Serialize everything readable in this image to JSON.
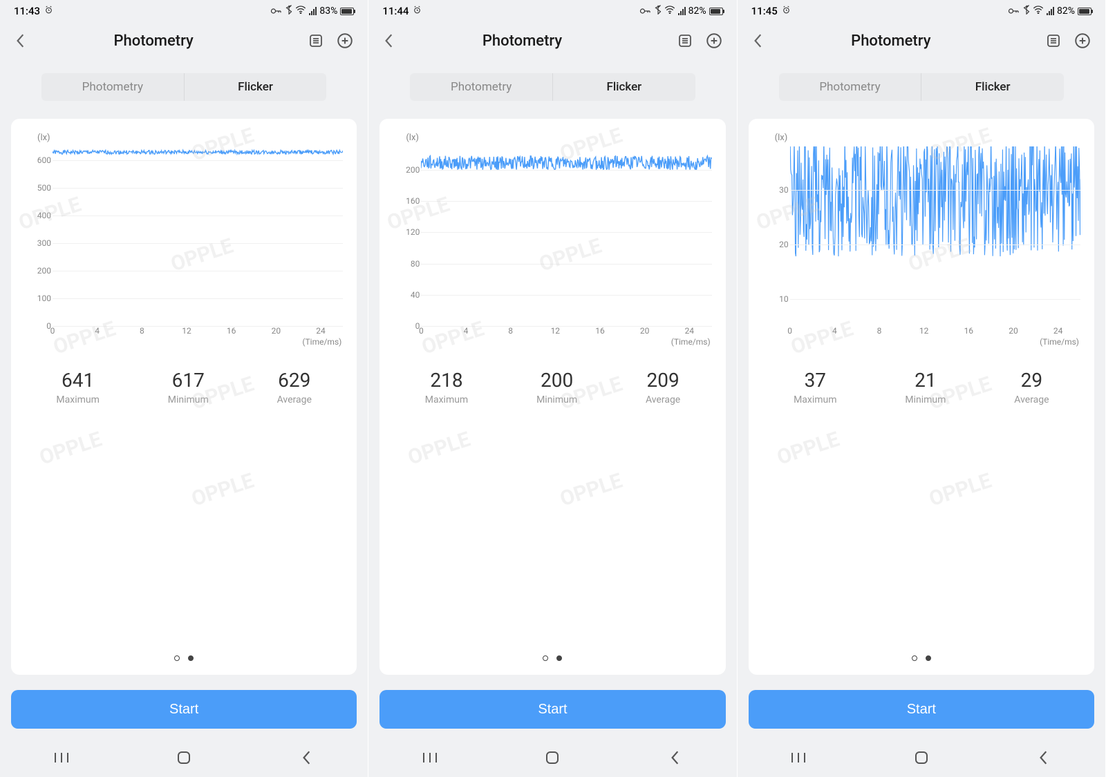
{
  "screens": [
    {
      "status": {
        "time": "11:43",
        "battery_pct": "83%",
        "battery_fill": 83
      },
      "header": {
        "title": "Photometry"
      },
      "tabs": {
        "photometry": "Photometry",
        "flicker": "Flicker",
        "active": "flicker"
      },
      "chart": {
        "unit": "(lx)",
        "y_ticks": [
          0,
          100,
          200,
          300,
          400,
          500,
          600
        ],
        "y_max": 650,
        "x_ticks": [
          0,
          4,
          8,
          12,
          16,
          20,
          24
        ],
        "x_max": 26,
        "x_label": "(Time/ms)",
        "mean": 629,
        "amp": 12,
        "noise": 1.2
      },
      "stats": {
        "max_val": "641",
        "max_lab": "Maximum",
        "min_val": "617",
        "min_lab": "Minimum",
        "avg_val": "629",
        "avg_lab": "Average"
      },
      "start": "Start",
      "watermark": "OPPLE"
    },
    {
      "status": {
        "time": "11:44",
        "battery_pct": "82%",
        "battery_fill": 82
      },
      "header": {
        "title": "Photometry"
      },
      "tabs": {
        "photometry": "Photometry",
        "flicker": "Flicker",
        "active": "flicker"
      },
      "chart": {
        "unit": "(lx)",
        "y_ticks": [
          0,
          40,
          80,
          120,
          160,
          200
        ],
        "y_max": 230,
        "x_ticks": [
          0,
          4,
          8,
          12,
          16,
          20,
          24
        ],
        "x_max": 26,
        "x_label": "(Time/ms)",
        "mean": 209,
        "amp": 9,
        "noise": 2.0
      },
      "stats": {
        "max_val": "218",
        "max_lab": "Maximum",
        "min_val": "200",
        "min_lab": "Minimum",
        "avg_val": "209",
        "avg_lab": "Average"
      },
      "start": "Start",
      "watermark": "OPPLE"
    },
    {
      "status": {
        "time": "11:45",
        "battery_pct": "82%",
        "battery_fill": 82
      },
      "header": {
        "title": "Photometry"
      },
      "tabs": {
        "photometry": "Photometry",
        "flicker": "Flicker",
        "active": "flicker"
      },
      "chart": {
        "unit": "(lx)",
        "y_ticks": [
          10,
          20,
          30
        ],
        "y_max": 38,
        "y_min": 5,
        "x_ticks": [
          0,
          4,
          8,
          12,
          16,
          20,
          24
        ],
        "x_max": 26,
        "x_label": "(Time/ms)",
        "mean": 29,
        "amp": 8,
        "noise": 2.8
      },
      "stats": {
        "max_val": "37",
        "max_lab": "Maximum",
        "min_val": "21",
        "min_lab": "Minimum",
        "avg_val": "29",
        "avg_lab": "Average"
      },
      "start": "Start",
      "watermark": "OPPLE"
    }
  ],
  "chart_data": [
    {
      "type": "line",
      "title": "Flicker",
      "xlabel": "Time/ms",
      "ylabel": "lx",
      "x_range": [
        0,
        26
      ],
      "y_range": [
        0,
        650
      ],
      "summary": {
        "maximum": 641,
        "minimum": 617,
        "average": 629
      },
      "x_ticks": [
        0,
        4,
        8,
        12,
        16,
        20,
        24
      ],
      "y_ticks": [
        0,
        100,
        200,
        300,
        400,
        500,
        600
      ],
      "note": "noisy near-flat line around 629 lx, amplitude ≈12"
    },
    {
      "type": "line",
      "title": "Flicker",
      "xlabel": "Time/ms",
      "ylabel": "lx",
      "x_range": [
        0,
        26
      ],
      "y_range": [
        0,
        230
      ],
      "summary": {
        "maximum": 218,
        "minimum": 200,
        "average": 209
      },
      "x_ticks": [
        0,
        4,
        8,
        12,
        16,
        20,
        24
      ],
      "y_ticks": [
        0,
        40,
        80,
        120,
        160,
        200
      ],
      "note": "noisy near-flat line around 209 lx, amplitude ≈9"
    },
    {
      "type": "line",
      "title": "Flicker",
      "xlabel": "Time/ms",
      "ylabel": "lx",
      "x_range": [
        0,
        26
      ],
      "y_range": [
        5,
        38
      ],
      "summary": {
        "maximum": 37,
        "minimum": 21,
        "average": 29
      },
      "x_ticks": [
        0,
        4,
        8,
        12,
        16,
        20,
        24
      ],
      "y_ticks": [
        10,
        20,
        30
      ],
      "note": "very noisy line around 29 lx, amplitude ≈8"
    }
  ]
}
